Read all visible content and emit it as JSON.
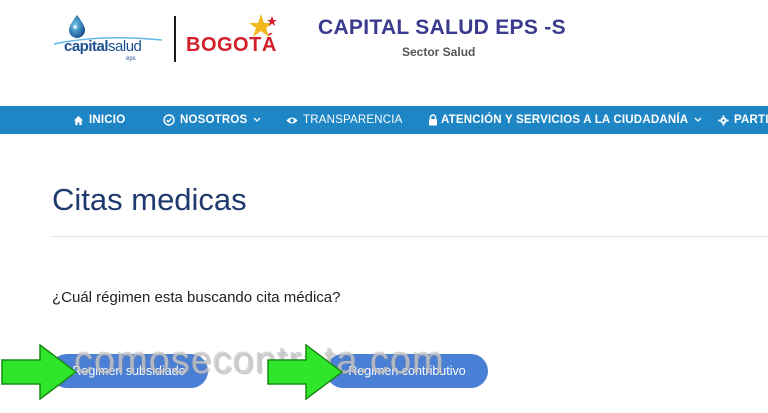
{
  "header": {
    "logo_capital_word_bold": "capital",
    "logo_capital_word_rest": "salud",
    "logo_capital_eps": "eps",
    "logo_bogota_text": "BOGOTÁ",
    "site_title": "CAPITAL SALUD EPS -S",
    "site_subtitle": "Sector Salud"
  },
  "nav": {
    "items": [
      {
        "label": "INICIO",
        "icon": "home-icon"
      },
      {
        "label": "NOSOTROS",
        "icon": "check-circle-icon",
        "dropdown": true
      },
      {
        "label": "TRANSPARENCIA",
        "icon": "eye-icon"
      },
      {
        "label": "ATENCIÓN Y SERVICIOS A LA CIUDADANÍA",
        "icon": "lock-icon",
        "dropdown": true
      },
      {
        "label": "PARTI",
        "icon": "gear-icon"
      }
    ]
  },
  "main": {
    "title": "Citas medicas",
    "question": "¿Cuál régimen esta buscando cita médica?",
    "buttons": {
      "subsidiado": "Regimen subsidiado",
      "contributivo": "Regimen contributivo"
    }
  },
  "watermark": "comosecontrata.com",
  "colors": {
    "nav_bg": "#1f86c6",
    "title": "#1e3a6e",
    "site_title": "#3a3a8f",
    "button": "#4a7fd6",
    "arrow": "#2fe62a",
    "bogota_red": "#d21f2b"
  }
}
